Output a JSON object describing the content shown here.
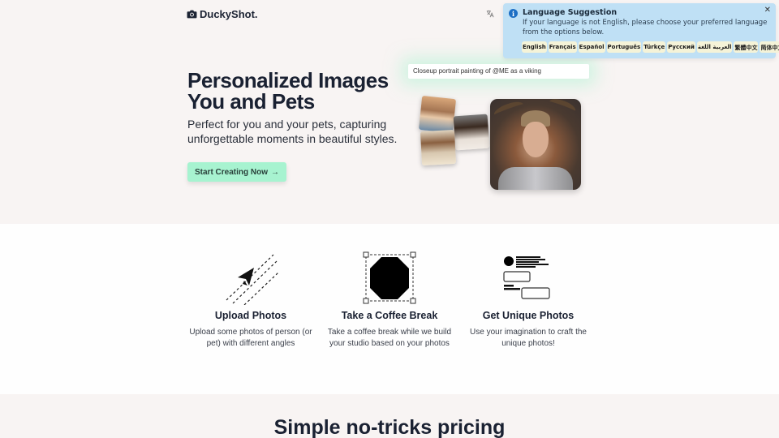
{
  "header": {
    "brand": "DuckyShot.",
    "brand_icon": "camera-icon",
    "language_icon": "translate-icon"
  },
  "hero": {
    "title_line1": "Personalized Images",
    "title_line2": "You and Pets",
    "subtitle": "Perfect for you and your pets, capturing unforgettable moments in beautiful styles.",
    "cta_label": "Start Creating Now",
    "cta_icon": "arrow-right-icon",
    "prompt_text": "Closeup portrait painting of @ME as a viking",
    "accent_color": "#a7f3d0"
  },
  "language_toast": {
    "title": "Language Suggestion",
    "message": "If your language is not English, please choose your preferred language from the options below.",
    "icon": "info-icon",
    "close_icon": "close-icon",
    "languages": [
      "English",
      "Français",
      "Español",
      "Português",
      "Türkçe",
      "Русский",
      "العربية اللغة",
      "繁體中文",
      "简体中文"
    ],
    "background_color": "#bfe0f5"
  },
  "features": [
    {
      "icon": "paper-plane-icon",
      "title": "Upload Photos",
      "description": "Upload some photos of person (or pet) with different angles"
    },
    {
      "icon": "octagon-selection-icon",
      "title": "Take a Coffee Break",
      "description": "Take a coffee break while we build your studio based on your photos"
    },
    {
      "icon": "layout-form-icon",
      "title": "Get Unique Photos",
      "description": "Use your imagination to craft the unique photos!"
    }
  ],
  "pricing": {
    "title": "Simple no-tricks pricing"
  }
}
